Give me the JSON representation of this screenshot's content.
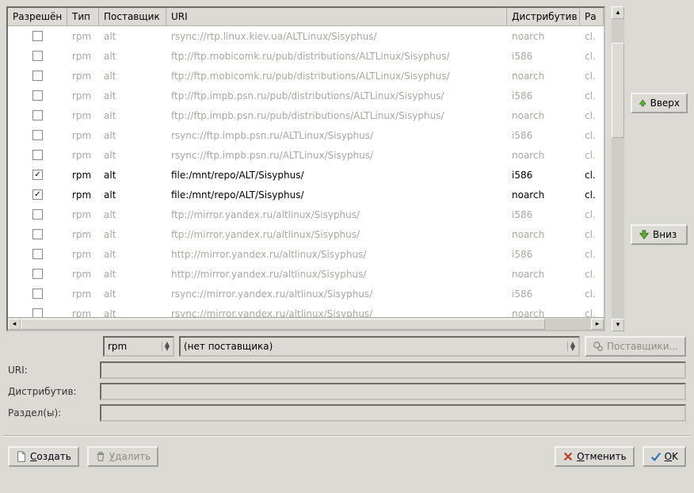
{
  "columns": {
    "enabled": "Разрешён",
    "type": "Тип",
    "vendor": "Поставщик",
    "uri": "URI",
    "dist": "Дистрибутив",
    "sect": "Ра"
  },
  "rows": [
    {
      "enabled": false,
      "type": "rpm",
      "vendor": "alt",
      "uri": "rsync://rtp.linux.kiev.ua/ALTLinux/Sisyphus/",
      "dist": "noarch",
      "sect": "cl."
    },
    {
      "enabled": false,
      "type": "rpm",
      "vendor": "alt",
      "uri": "ftp://ftp.mobicomk.ru/pub/distributions/ALTLinux/Sisyphus/",
      "dist": "i586",
      "sect": "cl."
    },
    {
      "enabled": false,
      "type": "rpm",
      "vendor": "alt",
      "uri": "ftp://ftp.mobicomk.ru/pub/distributions/ALTLinux/Sisyphus/",
      "dist": "noarch",
      "sect": "cl."
    },
    {
      "enabled": false,
      "type": "rpm",
      "vendor": "alt",
      "uri": "ftp://ftp.impb.psn.ru/pub/distributions/ALTLinux/Sisyphus/",
      "dist": "i586",
      "sect": "cl."
    },
    {
      "enabled": false,
      "type": "rpm",
      "vendor": "alt",
      "uri": "ftp://ftp.impb.psn.ru/pub/distributions/ALTLinux/Sisyphus/",
      "dist": "noarch",
      "sect": "cl."
    },
    {
      "enabled": false,
      "type": "rpm",
      "vendor": "alt",
      "uri": "rsync://ftp.impb.psn.ru/ALTLinux/Sisyphus/",
      "dist": "i586",
      "sect": "cl."
    },
    {
      "enabled": false,
      "type": "rpm",
      "vendor": "alt",
      "uri": "rsync://ftp.impb.psn.ru/ALTLinux/Sisyphus/",
      "dist": "noarch",
      "sect": "cl."
    },
    {
      "enabled": true,
      "type": "rpm",
      "vendor": "alt",
      "uri": "file:/mnt/repo/ALT/Sisyphus/",
      "dist": "i586",
      "sect": "cl."
    },
    {
      "enabled": true,
      "type": "rpm",
      "vendor": "alt",
      "uri": "file:/mnt/repo/ALT/Sisyphus/",
      "dist": "noarch",
      "sect": "cl."
    },
    {
      "enabled": false,
      "type": "rpm",
      "vendor": "alt",
      "uri": "ftp://mirror.yandex.ru/altlinux/Sisyphus/",
      "dist": "i586",
      "sect": "cl."
    },
    {
      "enabled": false,
      "type": "rpm",
      "vendor": "alt",
      "uri": "ftp://mirror.yandex.ru/altlinux/Sisyphus/",
      "dist": "noarch",
      "sect": "cl."
    },
    {
      "enabled": false,
      "type": "rpm",
      "vendor": "alt",
      "uri": "http://mirror.yandex.ru/altlinux/Sisyphus/",
      "dist": "i586",
      "sect": "cl."
    },
    {
      "enabled": false,
      "type": "rpm",
      "vendor": "alt",
      "uri": "http://mirror.yandex.ru/altlinux/Sisyphus/",
      "dist": "noarch",
      "sect": "cl."
    },
    {
      "enabled": false,
      "type": "rpm",
      "vendor": "alt",
      "uri": "rsync://mirror.yandex.ru/altlinux/Sisyphus/",
      "dist": "i586",
      "sect": "cl."
    },
    {
      "enabled": false,
      "type": "rpm",
      "vendor": "alt",
      "uri": "rsync://mirror.yandex.ru/altlinux/Sisyphus/",
      "dist": "noarch",
      "sect": "cl."
    }
  ],
  "side": {
    "up": "Вверх",
    "down": "Вниз"
  },
  "form": {
    "type_value": "rpm",
    "vendor_value": "(нет поставщика)",
    "vendors_btn": "Поставщики...",
    "uri_label": "URI:",
    "uri_value": "",
    "dist_label": "Дистрибутив:",
    "dist_value": "",
    "sect_label": "Раздел(ы):",
    "sect_value": ""
  },
  "buttons": {
    "create": "Создать",
    "delete": "Удалить",
    "cancel": "Отменить",
    "ok": "OK"
  }
}
